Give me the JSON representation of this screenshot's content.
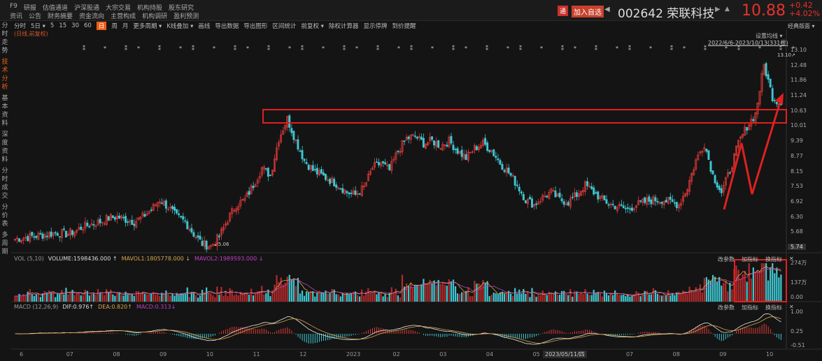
{
  "header": {
    "nav_row1": [
      "F9",
      "研报",
      "估值通道",
      "沪深股通",
      "大宗交易",
      "机构持股",
      "股东研究"
    ],
    "nav_row2": [
      "资讯",
      "公告",
      "财务摘要",
      "资金流向",
      "主营构成",
      "机构调研",
      "盈利预测"
    ],
    "tong": "通",
    "add_fav": "加入自选",
    "code_name": "002642 荣联科技",
    "price": "10.88",
    "change": "+0.42",
    "change_pct": "+4.02%"
  },
  "toolbar": [
    "分时",
    "5日 ▾",
    "5",
    "15",
    "30",
    "60",
    "日",
    "周",
    "月",
    "更多周期 ▾",
    "K线叠加 ▾",
    "画线",
    "导出数据",
    "导出图形",
    "区间统计",
    "前复权 ▾",
    "除权计算器",
    "显示停牌",
    "到价提醒"
  ],
  "toolbar_active": 6,
  "side_tabs": [
    "分时走势",
    "技术分析",
    "基本资料",
    "深度资料",
    "分时成交",
    "分价表",
    "多周期"
  ],
  "subtitle": "(日线,前复权)",
  "classic": "经典版面 ▾",
  "set_ma": "设置均线 ▾",
  "range": "2022/6/6-2023/10/13(331根)",
  "high_label": "13.10↗",
  "low_label": "↙5.06",
  "price_axis": [
    "13.10",
    "12.48",
    "11.86",
    "11.24",
    "10.63",
    "10.01",
    "9.39",
    "8.77",
    "8.15",
    "7.53",
    "6.92",
    "6.30",
    "5.68",
    "5.06"
  ],
  "current_price_tag": "5.74",
  "vol": {
    "name": "VOL (5,10)",
    "volume": "VOLUME:1598436.000 ↑",
    "mavol1": "MAVOL1:1805778.000 ↓",
    "mavol2": "MAVOL2:1989593.000 ↓",
    "axis": [
      "274万",
      "137万",
      "0.00"
    ]
  },
  "macd": {
    "name": "MACD (12,26,9)",
    "dif": "DIF:0.976↑",
    "dea": "DEA:0.820↑",
    "macd": "MACD:0.313↓",
    "axis": [
      "1.00",
      "0.25",
      "-0.51"
    ]
  },
  "panel_tools": [
    "改参数",
    "加指标",
    "换指标",
    "✕"
  ],
  "months": [
    "6",
    "07",
    "08",
    "09",
    "10",
    "11",
    "12",
    "2023",
    "02",
    "03",
    "04",
    "05",
    "06",
    "07",
    "08",
    "09",
    "10"
  ],
  "cursor_date": "2023/05/11/四",
  "chart_data": {
    "type": "candlestick",
    "ylim": [
      5.06,
      13.1
    ],
    "closes": [
      5.4,
      5.45,
      5.5,
      5.55,
      5.6,
      5.65,
      5.6,
      5.7,
      5.9,
      6.0,
      6.1,
      6.25,
      6.3,
      6.2,
      6.1,
      6.3,
      6.6,
      7.0,
      6.7,
      6.3,
      6.1,
      5.6,
      5.2,
      5.1,
      5.5,
      6.2,
      6.8,
      7.0,
      7.6,
      8.3,
      8.0,
      9.5,
      10.3,
      9.4,
      8.6,
      8.2,
      8.0,
      7.8,
      7.6,
      7.3,
      7.2,
      7.5,
      8.3,
      8.5,
      8.2,
      9.0,
      9.5,
      9.6,
      9.3,
      9.4,
      9.2,
      9.4,
      9.0,
      8.7,
      9.1,
      9.3,
      9.0,
      8.5,
      8.1,
      7.6,
      7.0,
      6.8,
      7.1,
      7.3,
      7.0,
      6.9,
      7.2,
      7.6,
      7.3,
      7.0,
      6.8,
      6.7,
      6.6,
      6.8,
      6.9,
      7.0,
      7.0,
      6.9,
      6.8,
      7.5,
      8.6,
      9.3,
      8.0,
      7.3,
      8.2,
      9.3,
      10.0,
      10.5,
      12.5,
      11.2,
      10.88
    ],
    "colors": {
      "up": "#e03a3a",
      "down": "#3ec6d0",
      "ma1": "#d6a64a",
      "ma2": "#c040c0",
      "dif": "#e8e8e8"
    }
  }
}
